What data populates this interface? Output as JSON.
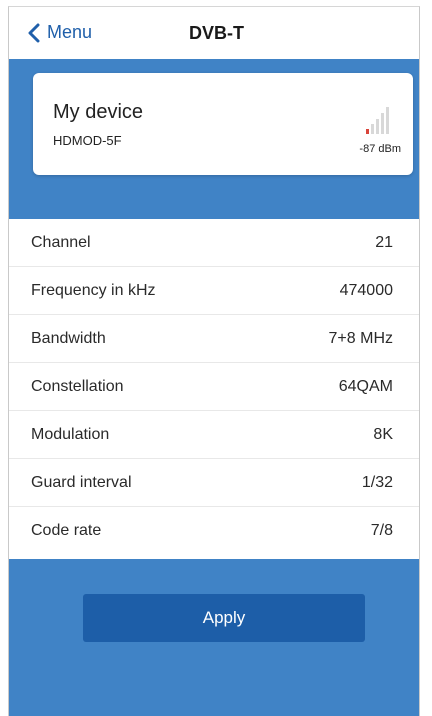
{
  "nav": {
    "back_label": "Menu",
    "title": "DVB-T"
  },
  "device": {
    "name": "My device",
    "model": "HDMOD-5F",
    "signal_strength": "-87 dBm"
  },
  "parameters": [
    {
      "label": "Channel",
      "value": "21"
    },
    {
      "label": "Frequency in kHz",
      "value": "474000"
    },
    {
      "label": "Bandwidth",
      "value": "7+8 MHz"
    },
    {
      "label": "Constellation",
      "value": "64QAM"
    },
    {
      "label": "Modulation",
      "value": "8K"
    },
    {
      "label": "Guard interval",
      "value": "1/32"
    },
    {
      "label": "Code rate",
      "value": "7/8"
    }
  ],
  "actions": {
    "apply_label": "Apply"
  },
  "colors": {
    "accent_blue": "#4083c6",
    "button_blue": "#1d5ea8",
    "link_blue": "#1f5faa",
    "signal_red": "#d9443a"
  }
}
